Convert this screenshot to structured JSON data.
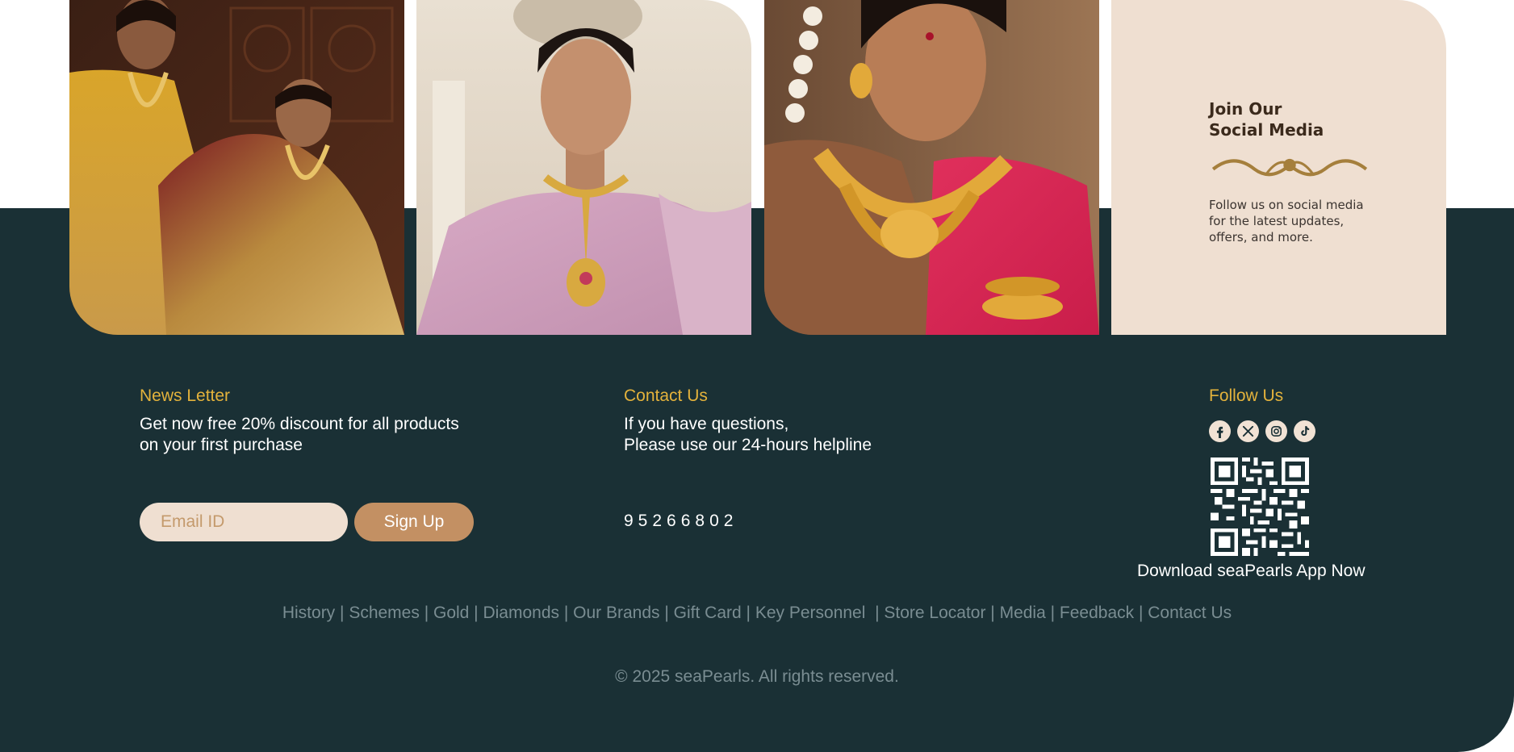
{
  "social_card": {
    "title_line1": "Join Our",
    "title_line2": "Social Media",
    "text": "Follow us on social media for the latest updates, offers, and more."
  },
  "newsletter": {
    "heading": "News Letter",
    "line1": "Get now free 20% discount for all products",
    "line2": "on your first purchase",
    "email_placeholder": "Email ID",
    "signup_label": "Sign Up"
  },
  "contact": {
    "heading": "Contact Us",
    "line1": "If you have questions,",
    "line2": "Please use our 24-hours helpline",
    "phone": "95266802"
  },
  "follow": {
    "heading": "Follow Us",
    "icons": [
      "facebook-icon",
      "x-icon",
      "instagram-icon",
      "tiktok-icon"
    ],
    "app_text": "Download seaPearls App Now"
  },
  "links": [
    {
      "label": "History",
      "sep": " | "
    },
    {
      "label": "Schemes",
      "sep": " | "
    },
    {
      "label": "Gold",
      "sep": " | "
    },
    {
      "label": "Diamonds",
      "sep": " | "
    },
    {
      "label": "Our Brands",
      "sep": " | "
    },
    {
      "label": "Gift Card",
      "sep": " | "
    },
    {
      "label": "Key Personnel",
      "sep": "  | "
    },
    {
      "label": "Store Locator",
      "sep": " | "
    },
    {
      "label": "Media",
      "sep": " | "
    },
    {
      "label": "Feedback",
      "sep": " | "
    },
    {
      "label": "Contact Us",
      "sep": ""
    }
  ],
  "copyright": "© 2025 seaPearls. All rights reserved.",
  "colors": {
    "footer_bg": "#1a3035",
    "accent_gold": "#e3b23c",
    "beige": "#efdfd1",
    "button_brown": "#c39063",
    "muted_text": "#7a8d92"
  }
}
